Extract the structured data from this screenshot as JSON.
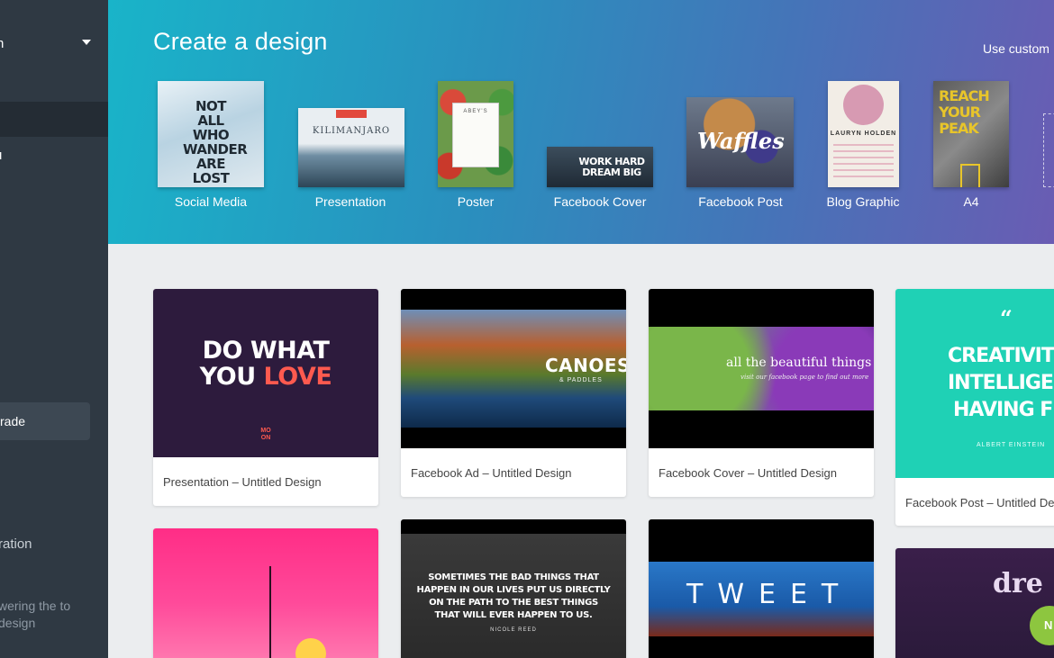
{
  "sidebar": {
    "top_label": "n",
    "item2": "u",
    "upgrade": "rade",
    "collab": "ration",
    "blurb": "wering the to design"
  },
  "header": {
    "title": "Create a design",
    "use_custom": "Use custom"
  },
  "design_types": [
    {
      "label": "Social Media",
      "thumb_text": "NOT ALL WHO WANDER ARE LOST"
    },
    {
      "label": "Presentation",
      "thumb_text": "KILIMANJARO"
    },
    {
      "label": "Poster",
      "thumb_text": "ABEY'S"
    },
    {
      "label": "Facebook Cover",
      "thumb_text": "WORK HARD DREAM BIG"
    },
    {
      "label": "Facebook Post",
      "thumb_text": "Waffles"
    },
    {
      "label": "Blog Graphic",
      "thumb_text": "LAURYN HOLDEN"
    },
    {
      "label": "A4",
      "thumb_text": "REACH YOUR PEAK"
    }
  ],
  "designs": [
    {
      "caption": "Presentation – Untitled Design",
      "line1": "DO WHAT",
      "line2a": "YOU ",
      "line2b": "LOVE",
      "small": "MO ON"
    },
    {
      "caption": "Facebook Ad – Untitled Design",
      "title": "CANOES",
      "sub": "& PADDLES"
    },
    {
      "caption": "Facebook Cover – Untitled Design",
      "title": "all the beautiful things",
      "sub": "visit our facebook page to find out more"
    },
    {
      "caption": "Facebook Post – Untitled De",
      "quote": "“",
      "l1": "CREATIVITY",
      "l2": "INTELLIGENC",
      "l3": "HAVING FU",
      "author": "ALBERT EINSTEIN"
    },
    {
      "caption": ""
    },
    {
      "caption": "",
      "quote": "SOMETIMES THE BAD THINGS THAT HAPPEN IN OUR LIVES PUT US DIRECTLY ON THE PATH TO THE BEST THINGS THAT WILL EVER HAPPEN TO US.",
      "author": "NICOLE REED"
    },
    {
      "caption": "",
      "title": "TWEET"
    },
    {
      "caption": "",
      "title": "dre"
    }
  ],
  "chat": {
    "label": "N"
  },
  "colors": {
    "accent": "#19b4c9",
    "sidebar": "#2f3943",
    "teal_card": "#1fd1b5",
    "purple_card": "#2d1b3d",
    "coral": "#ff5a4f"
  }
}
